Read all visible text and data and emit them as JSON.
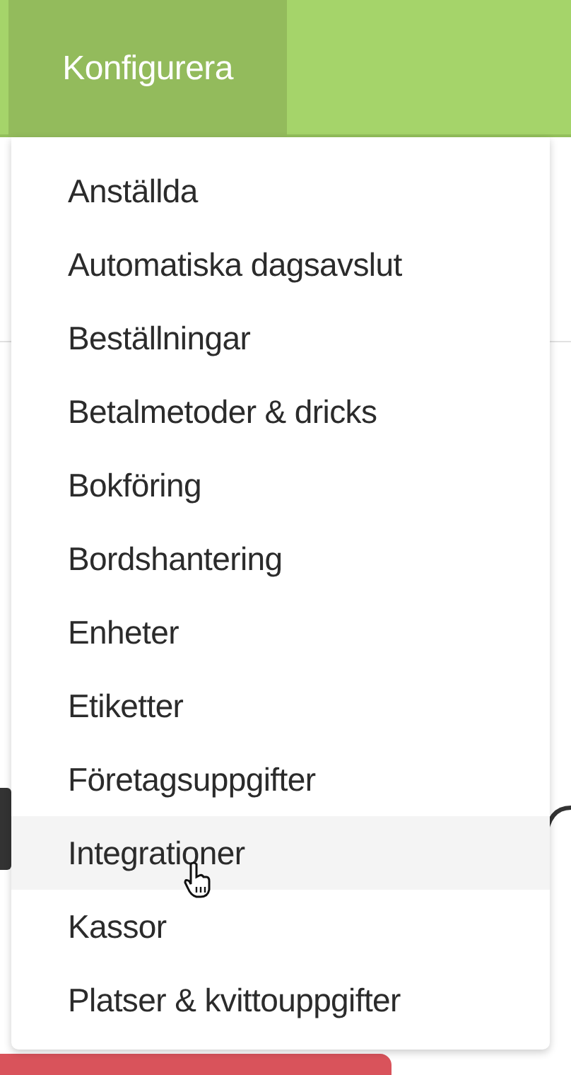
{
  "navbar": {
    "tabs": [
      {
        "label": "Konfigurera",
        "selected": true
      }
    ]
  },
  "dropdown_menu": {
    "items": [
      {
        "label": "Anställda",
        "hovered": false
      },
      {
        "label": "Automatiska dagsavslut",
        "hovered": false
      },
      {
        "label": "Beställningar",
        "hovered": false
      },
      {
        "label": "Betalmetoder & dricks",
        "hovered": false
      },
      {
        "label": "Bokföring",
        "hovered": false
      },
      {
        "label": "Bordshantering",
        "hovered": false
      },
      {
        "label": "Enheter",
        "hovered": false
      },
      {
        "label": "Etiketter",
        "hovered": false
      },
      {
        "label": "Företagsuppgifter",
        "hovered": false
      },
      {
        "label": "Integrationer",
        "hovered": true
      },
      {
        "label": "Kassor",
        "hovered": false
      },
      {
        "label": "Platser & kvittouppgifter",
        "hovered": false
      }
    ]
  }
}
